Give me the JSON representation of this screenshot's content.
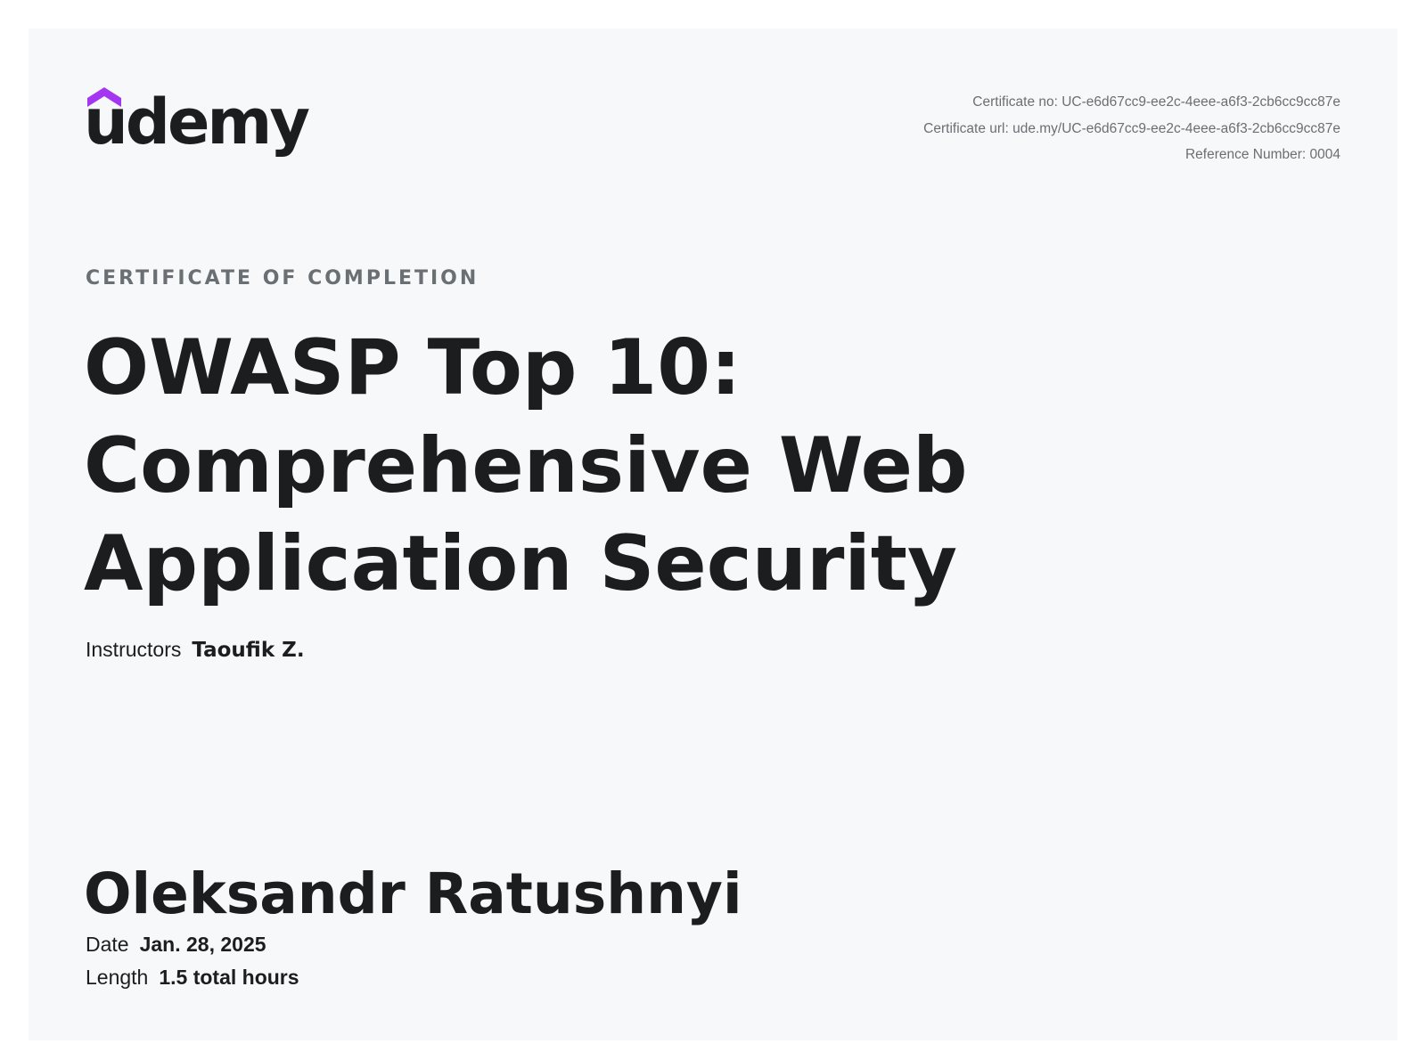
{
  "brand": {
    "name": "udemy",
    "accent_color": "#a435f0",
    "text_color": "#1c1d1f"
  },
  "meta": {
    "certificate_no": "Certificate no: UC-e6d67cc9-ee2c-4eee-a6f3-2cb6cc9cc87e",
    "certificate_url": "Certificate url: ude.my/UC-e6d67cc9-ee2c-4eee-a6f3-2cb6cc9cc87e",
    "reference_number": "Reference Number: 0004"
  },
  "certificate": {
    "type_label": "CERTIFICATE OF COMPLETION",
    "course_title_lines": [
      "OWASP Top 10:",
      "Comprehensive Web",
      "Application Security"
    ],
    "instructors_label": "Instructors",
    "instructors_value": "Taoufik Z.",
    "recipient_name": "Oleksandr Ratushnyi",
    "date_label": "Date",
    "date_value": "Jan. 28, 2025",
    "length_label": "Length",
    "length_value": "1.5 total hours"
  }
}
